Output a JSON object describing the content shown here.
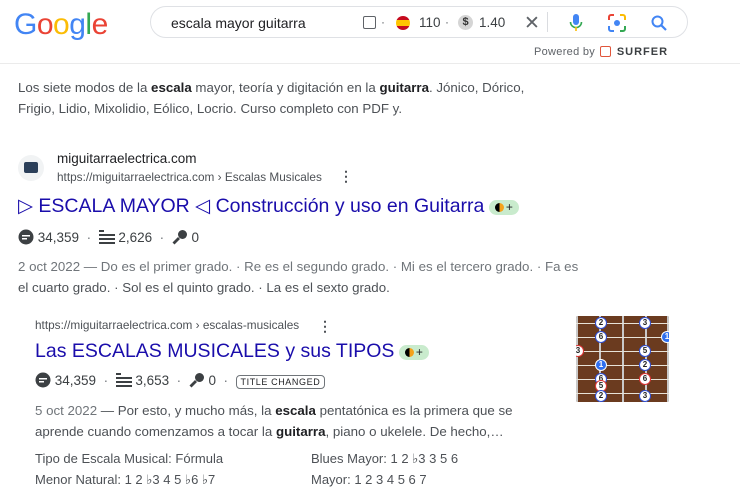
{
  "header": {
    "logo": "Google",
    "query": "escala mayor guitarra",
    "volume": "110",
    "cpc": "1.40",
    "powered_by": "Powered by",
    "surfer": "SURFER"
  },
  "prev_result": {
    "snippet_html_parts": [
      "Los siete modos de la ",
      "escala",
      " mayor, teoría y digitación en la ",
      "guitarra",
      ". Jónico, Dórico,"
    ],
    "snippet_line2": "Frigio, Lidio, Mixolidio, Eólico, Locrio. Curso completo con PDF y."
  },
  "result1": {
    "site": "miguitarraelectrica.com",
    "url": "https://miguitarraelectrica.com › Escalas Musicales",
    "title": "▷ ESCALA MAYOR ◁ Construcción y uso en Guitarra",
    "metric1": "34,359",
    "metric2": "2,626",
    "metric3": "0",
    "line1": "2 oct 2022 — Do es el primer grado. · Re es el segundo grado. · Mi es el tercero grado. · Fa es",
    "line2": "el cuarto grado. · Sol es el quinto grado. · La es el sexto grado."
  },
  "result2": {
    "url": "https://miguitarraelectrica.com › escalas-musicales",
    "title": "Las ESCALAS MUSICALES y sus TIPOS",
    "metric1": "34,359",
    "metric2": "3,653",
    "metric3": "0",
    "badge": "TITLE CHANGED",
    "date": "5 oct 2022",
    "line1_a": " — Por esto, y mucho más, la ",
    "line1_b": "escala",
    "line1_c": " pentatónica es la primera que se",
    "line2_a": "aprende cuando comenzamos a tocar la ",
    "line2_b": "guitarra",
    "line2_c": ", piano o ukelele. De hecho,…",
    "table": {
      "r1c1": "Tipo de Escala Musical: Fórmula",
      "r1c2": "Blues Mayor: 1 2 ♭3 3 5 6",
      "r2c1": "Menor Natural: 1 2 ♭3 4 5 ♭6 ♭7",
      "r2c2": "Mayor: 1 2 3 4 5 6 7"
    },
    "thumb_notes": [
      "2",
      "3",
      "6",
      "1",
      "3",
      "5",
      "1",
      "2",
      "6",
      "5",
      "6",
      "2",
      "3"
    ]
  }
}
